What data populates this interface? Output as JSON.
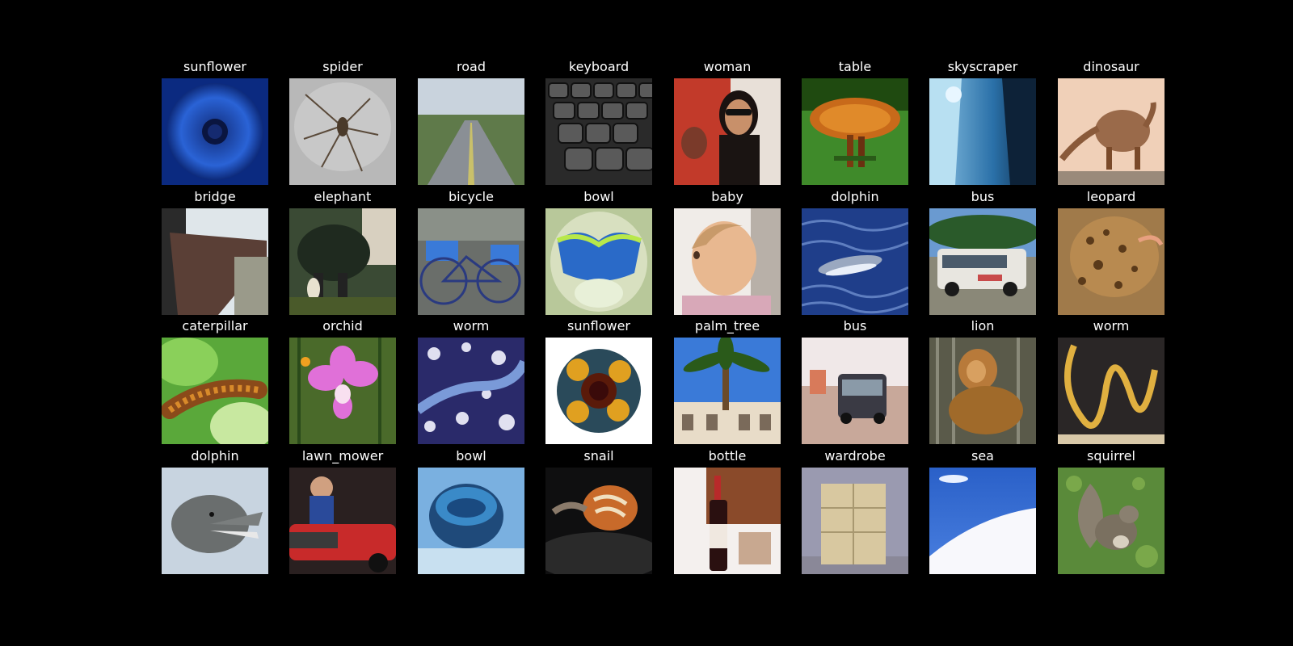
{
  "images": [
    {
      "label": "sunflower",
      "scene": "blue-flower"
    },
    {
      "label": "spider",
      "scene": "spider"
    },
    {
      "label": "road",
      "scene": "road"
    },
    {
      "label": "keyboard",
      "scene": "keyboard"
    },
    {
      "label": "woman",
      "scene": "woman"
    },
    {
      "label": "table",
      "scene": "table"
    },
    {
      "label": "skyscraper",
      "scene": "skyscraper"
    },
    {
      "label": "dinosaur",
      "scene": "dinosaur"
    },
    {
      "label": "bridge",
      "scene": "bridge"
    },
    {
      "label": "elephant",
      "scene": "elephant"
    },
    {
      "label": "bicycle",
      "scene": "bicycle"
    },
    {
      "label": "bowl",
      "scene": "bowl-green"
    },
    {
      "label": "baby",
      "scene": "baby"
    },
    {
      "label": "dolphin",
      "scene": "dolphin-water"
    },
    {
      "label": "bus",
      "scene": "van"
    },
    {
      "label": "leopard",
      "scene": "leopard"
    },
    {
      "label": "caterpillar",
      "scene": "caterpillar"
    },
    {
      "label": "orchid",
      "scene": "orchid"
    },
    {
      "label": "worm",
      "scene": "worm-blue"
    },
    {
      "label": "sunflower",
      "scene": "sunflower"
    },
    {
      "label": "palm_tree",
      "scene": "palm"
    },
    {
      "label": "bus",
      "scene": "bus-road"
    },
    {
      "label": "lion",
      "scene": "lion"
    },
    {
      "label": "worm",
      "scene": "worm-gold"
    },
    {
      "label": "dolphin",
      "scene": "dolphin-head"
    },
    {
      "label": "lawn_mower",
      "scene": "lawnmower"
    },
    {
      "label": "bowl",
      "scene": "bowl-blue"
    },
    {
      "label": "snail",
      "scene": "snail"
    },
    {
      "label": "bottle",
      "scene": "bottle"
    },
    {
      "label": "wardrobe",
      "scene": "wardrobe"
    },
    {
      "label": "sea",
      "scene": "sea"
    },
    {
      "label": "squirrel",
      "scene": "squirrel"
    }
  ]
}
